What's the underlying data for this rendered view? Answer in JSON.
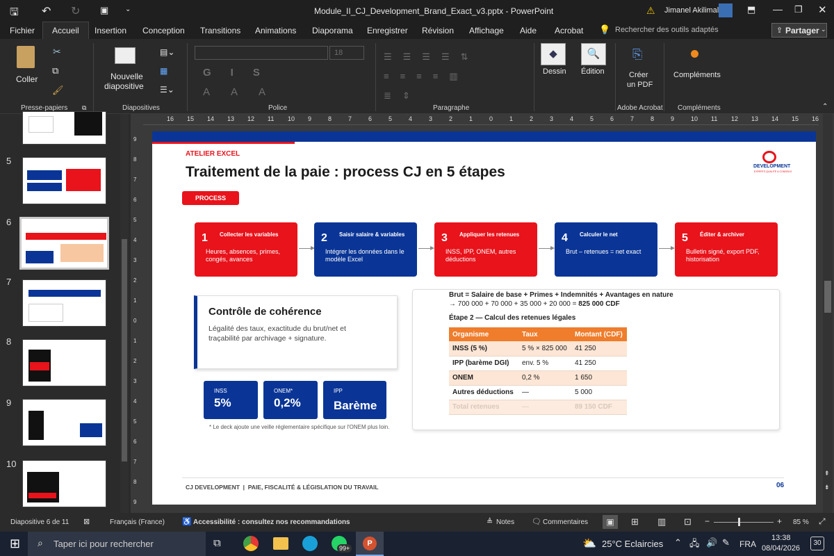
{
  "titlebar": {
    "filename": "Module_II_CJ_Development_Brand_Exact_v3.pptx",
    "separator": " - ",
    "app": "PowerPoint",
    "user": "Jimanel Akilimali"
  },
  "menu": [
    "Fichier",
    "Accueil",
    "Insertion",
    "Conception",
    "Transitions",
    "Animations",
    "Diaporama",
    "Enregistrer",
    "Révision",
    "Affichage",
    "Aide",
    "Acrobat"
  ],
  "search_placeholder": "Rechercher des outils adaptés",
  "share_label": "Partager",
  "ribbon": {
    "coller": "Coller",
    "nouvelle": "Nouvelle",
    "diapositive": "diapositive",
    "font_size": "18",
    "dessin": "Dessin",
    "edition": "Édition",
    "creer": "Créer",
    "un_pdf": "un PDF",
    "complements": "Compléments",
    "groups": [
      "Presse-papiers",
      "Diapositives",
      "Police",
      "Paragraphe",
      "Adobe Acrobat",
      "Compléments"
    ]
  },
  "thumbs": [
    "5",
    "6",
    "7",
    "8",
    "9",
    "10"
  ],
  "ruler_top": [
    "16",
    "15",
    "14",
    "13",
    "12",
    "11",
    "10",
    "9",
    "8",
    "7",
    "6",
    "5",
    "4",
    "3",
    "2",
    "1",
    "0",
    "1",
    "2",
    "3",
    "4",
    "5",
    "6",
    "7",
    "8",
    "9",
    "10",
    "11",
    "12",
    "13",
    "14",
    "15",
    "16"
  ],
  "ruler_left": [
    "9",
    "8",
    "7",
    "6",
    "5",
    "4",
    "3",
    "2",
    "1",
    "0",
    "1",
    "2",
    "3",
    "4",
    "5",
    "6",
    "7",
    "8",
    "9"
  ],
  "slide": {
    "eyebrow": "ATELIER EXCEL",
    "title": "Traitement de la paie : process CJ en 5 étapes",
    "badge": "PROCESS",
    "logo_text": "DEVELOPMENT",
    "logo_sub": "EXPERTS QUALITÉ & CONSEILS",
    "steps": [
      {
        "n": "1",
        "title": "Collecter les variables",
        "desc": "Heures, absences, primes, congés, avances"
      },
      {
        "n": "2",
        "title": "Saisir salaire & variables",
        "desc": "Intégrer les données dans le modèle Excel"
      },
      {
        "n": "3",
        "title": "Appliquer les retenues",
        "desc": "INSS, IPP, ONEM, autres déductions"
      },
      {
        "n": "4",
        "title": "Calculer le net",
        "desc": "Brut – retenues = net exact"
      },
      {
        "n": "5",
        "title": "Éditer & archiver",
        "desc": "Bulletin signé, export PDF, historisation"
      }
    ],
    "controle_title": "Contrôle de cohérence",
    "controle_desc": "Légalité des taux, exactitude du brut/net et traçabilité par archivage + signature.",
    "kpis": [
      {
        "label": "INSS",
        "value": "5%"
      },
      {
        "label": "ONEM*",
        "value": "0,2%"
      },
      {
        "label": "IPP",
        "value": "Barème"
      }
    ],
    "note": "* Le deck ajoute une veille réglementaire spécifique sur l'ONEM plus loin.",
    "formula": "Brut = Salaire de base + Primes + Indemnités + Avantages en nature",
    "calc_prefix": "→ 700 000 + 70 000 + 35 000 + 20 000 = ",
    "calc_result": "825 000 CDF",
    "etape2": "Étape 2 — Calcul des retenues légales",
    "table_headers": [
      "Organisme",
      "Taux",
      "Montant (CDF)"
    ],
    "table_rows": [
      [
        "INSS (5 %)",
        "5 % × 825 000",
        "41 250"
      ],
      [
        "IPP (barème DGI)",
        "env. 5 %",
        "41 250"
      ],
      [
        "ONEM",
        "0,2 %",
        "1 650"
      ],
      [
        "Autres déductions",
        "—",
        "5 000"
      ],
      [
        "Total retenues",
        "—",
        "89 150 CDF"
      ]
    ],
    "footer": "CJ DEVELOPMENT  |  PAIE, FISCALITÉ & LÉGISLATION DU TRAVAIL",
    "page": "06"
  },
  "status": {
    "slide": "Diapositive 6 de 11",
    "lang": "Français (France)",
    "access": "Accessibilité : consultez nos recommandations",
    "notes": "Notes",
    "comments": "Commentaires",
    "zoom": "85 %"
  },
  "taskbar": {
    "search": "Taper ici pour rechercher",
    "weather": "25°C Eclaircies",
    "lang": "FRA",
    "time": "13:38",
    "date": "08/04/2026",
    "badge": "99+",
    "notif": "30"
  }
}
